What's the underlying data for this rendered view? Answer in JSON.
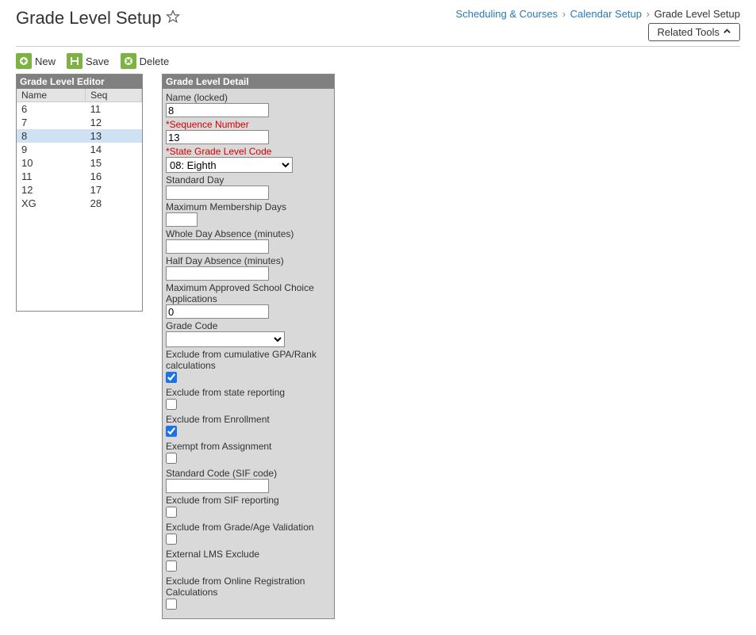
{
  "header": {
    "title": "Grade Level Setup",
    "breadcrumb": [
      {
        "label": "Scheduling & Courses",
        "link": true
      },
      {
        "label": "Calendar Setup",
        "link": true
      },
      {
        "label": "Grade Level Setup",
        "link": false
      }
    ],
    "related_tools_label": "Related Tools"
  },
  "toolbar": {
    "new_label": "New",
    "save_label": "Save",
    "delete_label": "Delete"
  },
  "editor": {
    "title": "Grade Level Editor",
    "col_name": "Name",
    "col_seq": "Seq",
    "rows": [
      {
        "name": "6",
        "seq": "11",
        "selected": false
      },
      {
        "name": "7",
        "seq": "12",
        "selected": false
      },
      {
        "name": "8",
        "seq": "13",
        "selected": true
      },
      {
        "name": "9",
        "seq": "14",
        "selected": false
      },
      {
        "name": "10",
        "seq": "15",
        "selected": false
      },
      {
        "name": "11",
        "seq": "16",
        "selected": false
      },
      {
        "name": "12",
        "seq": "17",
        "selected": false
      },
      {
        "name": "XG",
        "seq": "28",
        "selected": false
      }
    ]
  },
  "detail": {
    "title": "Grade Level Detail",
    "name_label": "Name (locked)",
    "name_value": "8",
    "seq_label": "*Sequence Number",
    "seq_value": "13",
    "state_code_label": "*State Grade Level Code",
    "state_code_value": "08: Eighth",
    "standard_day_label": "Standard Day",
    "standard_day_value": "",
    "max_membership_label": "Maximum Membership Days",
    "max_membership_value": "",
    "whole_day_label": "Whole Day Absence (minutes)",
    "whole_day_value": "",
    "half_day_label": "Half Day Absence (minutes)",
    "half_day_value": "",
    "max_choice_label": "Maximum Approved School Choice Applications",
    "max_choice_value": "0",
    "grade_code_label": "Grade Code",
    "grade_code_value": "",
    "exclude_gpa_label": "Exclude from cumulative GPA/Rank calculations",
    "exclude_gpa_checked": true,
    "exclude_state_label": "Exclude from state reporting",
    "exclude_state_checked": false,
    "exclude_enroll_label": "Exclude from Enrollment",
    "exclude_enroll_checked": true,
    "exempt_assign_label": "Exempt from Assignment",
    "exempt_assign_checked": false,
    "standard_sif_label": "Standard Code (SIF code)",
    "standard_sif_value": "",
    "exclude_sif_label": "Exclude from SIF reporting",
    "exclude_sif_checked": false,
    "exclude_grade_age_label": "Exclude from Grade/Age Validation",
    "exclude_grade_age_checked": false,
    "external_lms_label": "External LMS Exclude",
    "external_lms_checked": false,
    "exclude_online_reg_label": "Exclude from Online Registration Calculations",
    "exclude_online_reg_checked": false
  }
}
